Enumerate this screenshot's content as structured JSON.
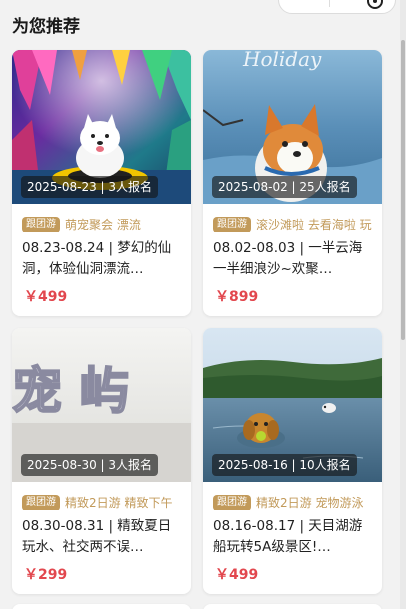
{
  "section_title": "为您推荐",
  "cards": [
    {
      "date_badge": "2025-08-23 | 3人报名",
      "group_tag": "跟团游",
      "keywords": "萌宠聚会  漂流",
      "title": "08.23-08.24 | 梦幻的仙洞，体验仙洞漂流…",
      "price": "￥499"
    },
    {
      "date_badge": "2025-08-02 | 25人报名",
      "group_tag": "跟团游",
      "keywords": "滚沙滩啦  去看海啦  玩",
      "title": "08.02-08.03 | 一半云海一半细浪沙~欢聚…",
      "price": "￥899"
    },
    {
      "date_badge": "2025-08-30 | 3人报名",
      "group_tag": "跟团游",
      "keywords": "精致2日游  精致下午",
      "title": "08.30-08.31 | 精致夏日 玩水、社交两不误…",
      "price": "￥299"
    },
    {
      "date_badge": "2025-08-16 | 10人报名",
      "group_tag": "跟团游",
      "keywords": "精致2日游  宠物游泳",
      "title": "08.16-08.17 | 天目湖游船玩转5A级景区!…",
      "price": "￥499"
    }
  ],
  "image_text": {
    "card2_overlay": "Holiday",
    "card3_sign": "宠 屿"
  }
}
